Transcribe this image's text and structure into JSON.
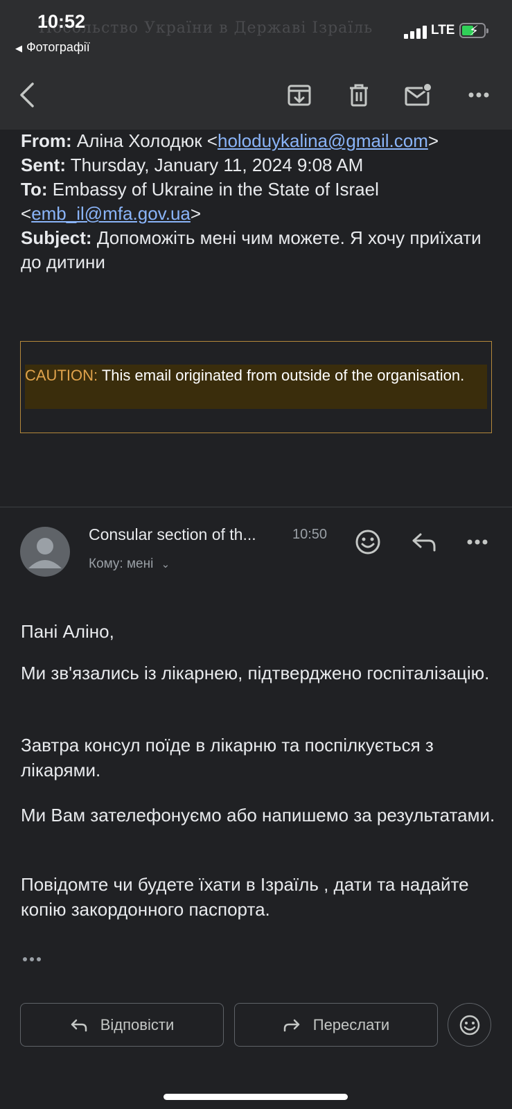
{
  "status_bar": {
    "time": "10:52",
    "back_app": "Фотографії",
    "ghost_title": "Посольство України в Державі Ізраїль",
    "network": "LTE",
    "battery_charging": true
  },
  "toolbar": {
    "back_icon": "back-arrow-icon",
    "archive_icon": "archive-icon",
    "delete_icon": "trash-icon",
    "mark_unread_icon": "mark-unread-icon",
    "more_icon": "more-icon"
  },
  "quoted_header": {
    "from_label": "From:",
    "from_name": "Аліна Холодюк <",
    "from_email": "holoduykalina@gmail.com",
    "from_close": ">",
    "sent_label": "Sent:",
    "sent_value": "Thursday, January 11, 2024 9:08 AM",
    "to_label": "To:",
    "to_name": "Embassy of Ukraine in the State of Israel",
    "to_open": "<",
    "to_email": "emb_il@mfa.gov.ua",
    "to_close": ">",
    "subject_label": "Subject:",
    "subject_value": "Допоможіть мені чим можете. Я хочу приїхати до дитини"
  },
  "caution": {
    "label": "CAUTION:",
    "text": "This email originated from outside of the organisation."
  },
  "message": {
    "sender": "Consular section of th...",
    "time": "10:50",
    "recipient": "Кому: мені",
    "greeting": "Пані Аліно,",
    "paragraphs": [
      "Ми зв'язались із лікарнею, підтверджено госпіталізацію.",
      "Завтра консул поїде в лікарню та поспілкується з лікарями.",
      "Ми Вам зателефонуємо або напишемо за результатами.",
      "Повідомте чи будете їхати в Ізраїль , дати та надайте копію закордонного паспорта."
    ],
    "ellipsis": "•••"
  },
  "actions": {
    "reply": "Відповісти",
    "forward": "Переслати"
  },
  "colors": {
    "background": "#202124",
    "link": "#8ab4f8",
    "caution_border": "#b5893b",
    "caution_label": "#e0a34c",
    "caution_bg": "#3a2d0c"
  }
}
